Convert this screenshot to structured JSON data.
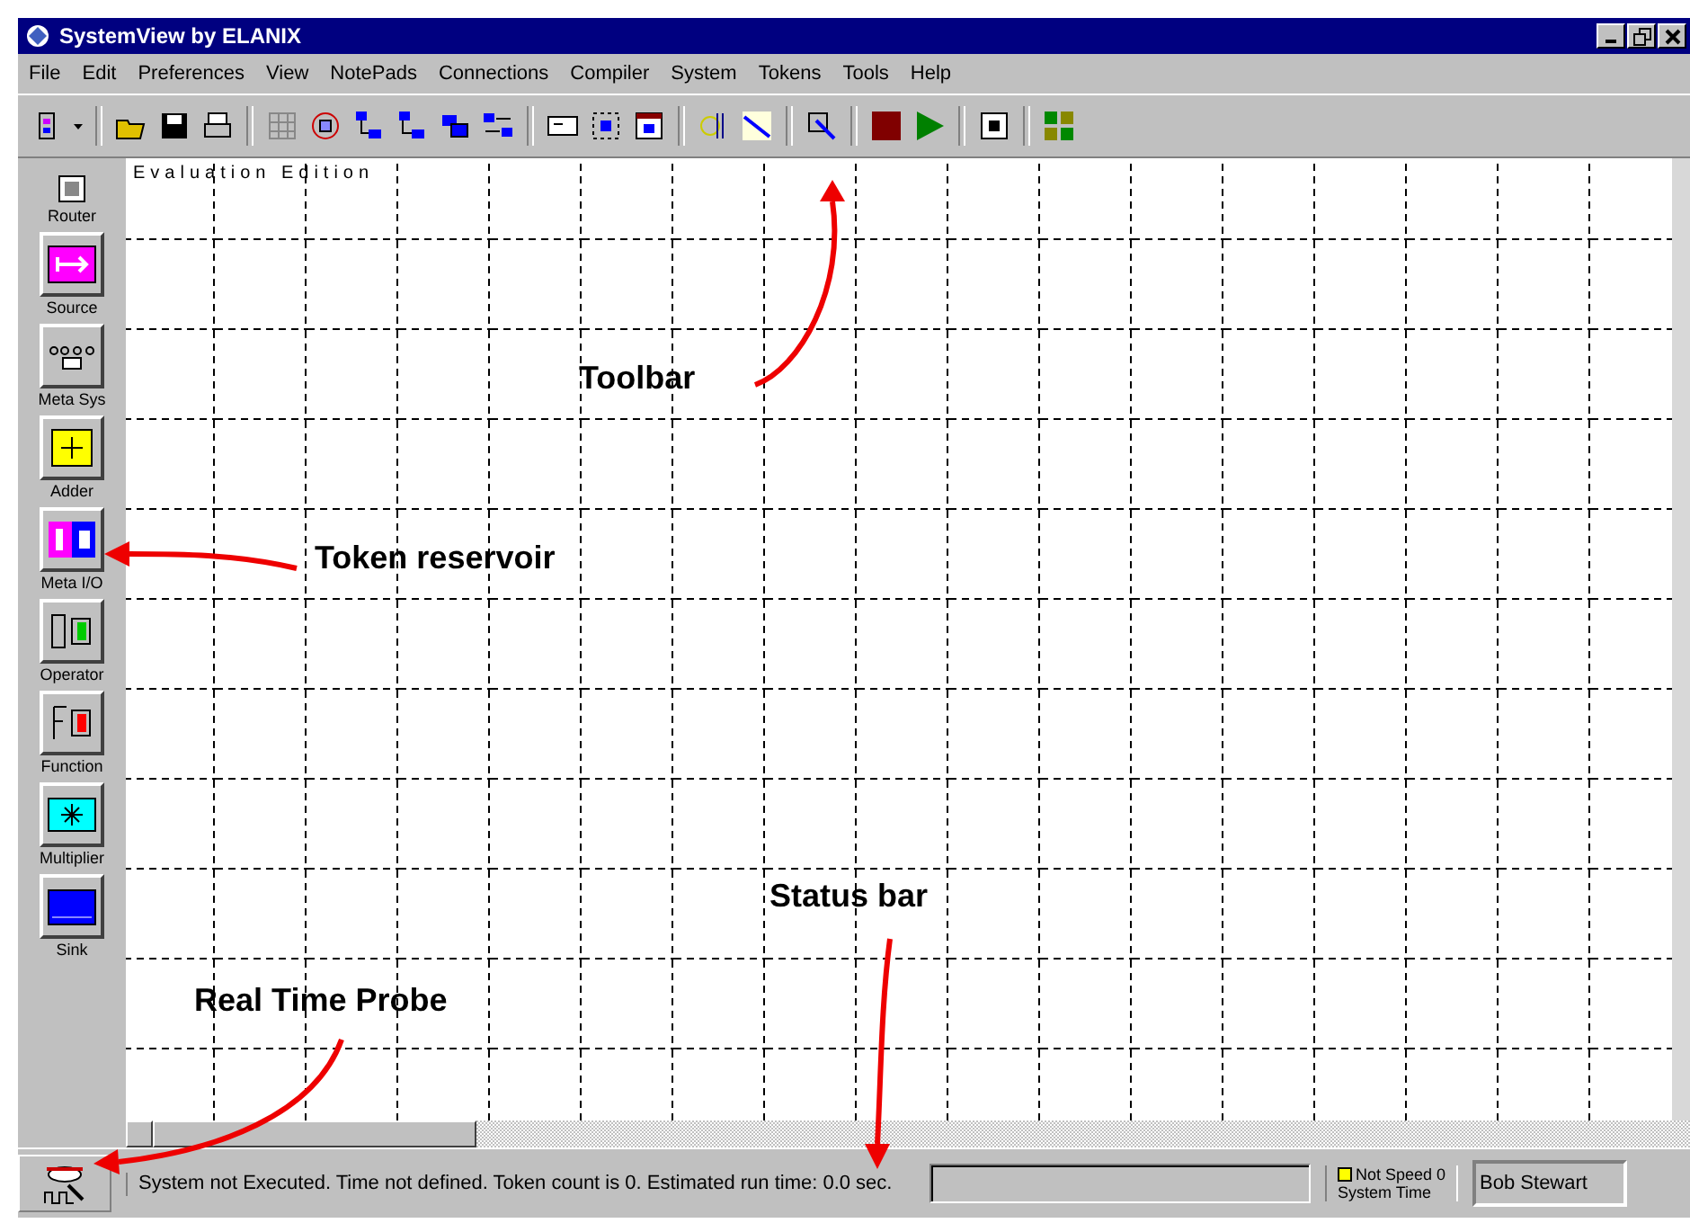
{
  "window": {
    "title": "SystemView by ELANIX"
  },
  "menu": [
    "File",
    "Edit",
    "Preferences",
    "View",
    "NotePads",
    "Connections",
    "Compiler",
    "System",
    "Tokens",
    "Tools",
    "Help"
  ],
  "palette": [
    {
      "label": "Router"
    },
    {
      "label": "Source"
    },
    {
      "label": "Meta Sys"
    },
    {
      "label": "Adder"
    },
    {
      "label": "Meta I/O"
    },
    {
      "label": "Operator"
    },
    {
      "label": "Function"
    },
    {
      "label": "Multiplier"
    },
    {
      "label": "Sink"
    }
  ],
  "canvas": {
    "watermark": "Evaluation Edition"
  },
  "annotations": [
    {
      "text": "Toolbar"
    },
    {
      "text": "Token reservoir"
    },
    {
      "text": "Status bar"
    },
    {
      "text": "Real Time Probe"
    }
  ],
  "status_bar": {
    "message": "System not Executed. Time not defined. Token count is 0.  Estimated run time: 0.0 sec.",
    "speed": "Not Speed 0",
    "time_label": "System Time",
    "user": "Bob Stewart"
  }
}
